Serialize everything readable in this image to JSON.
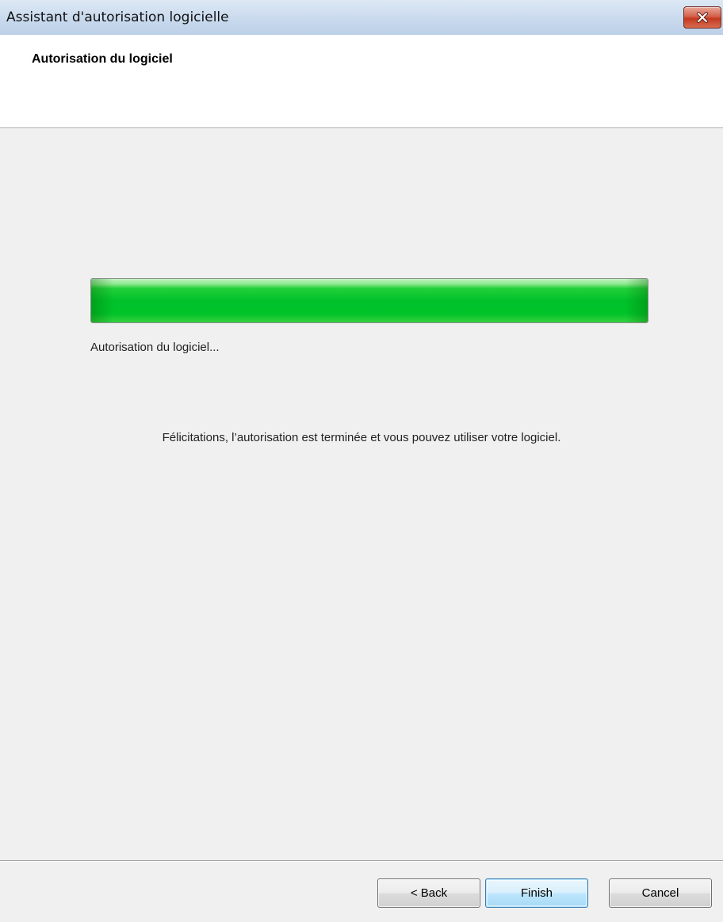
{
  "window": {
    "title": "Assistant d'autorisation logicielle"
  },
  "header": {
    "title": "Autorisation du logiciel"
  },
  "progress": {
    "value_percent": 100,
    "color": "#00c12a",
    "status_text": "Autorisation du logiciel..."
  },
  "message": "Félicitations, l’autorisation est terminée et vous pouvez utiliser votre logiciel.",
  "buttons": {
    "back": "< Back",
    "finish": "Finish",
    "cancel": "Cancel"
  },
  "icons": {
    "close": "close-icon"
  }
}
